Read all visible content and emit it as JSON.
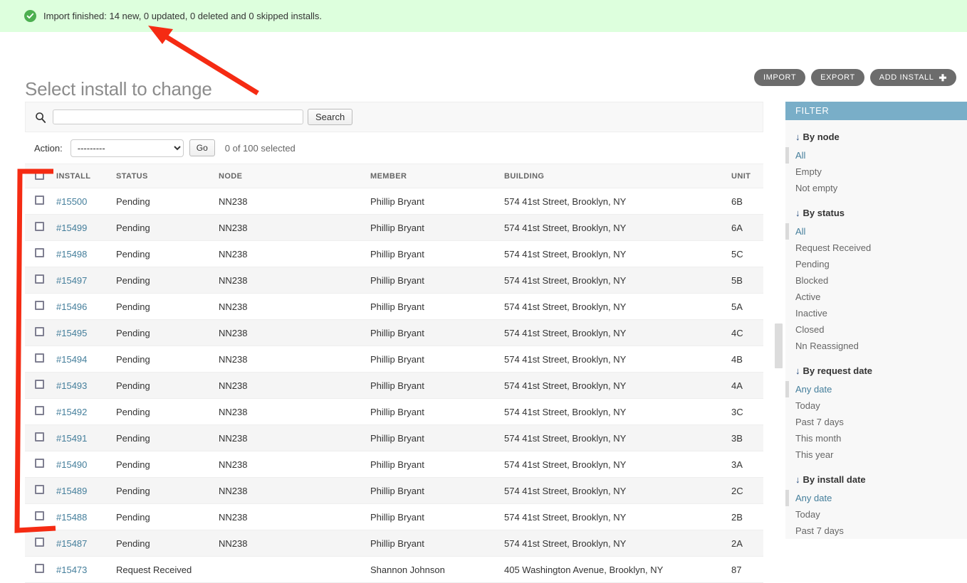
{
  "banner": {
    "icon": "check-circle-icon",
    "message": "Import finished: 14 new, 0 updated, 0 deleted and 0 skipped installs."
  },
  "header": {
    "title": "Select install to change",
    "tools": [
      {
        "label": "IMPORT",
        "name": "import-button"
      },
      {
        "label": "EXPORT",
        "name": "export-button"
      },
      {
        "label": "ADD INSTALL",
        "name": "add-install-button",
        "plus": "➕"
      }
    ]
  },
  "search": {
    "icon": "search-icon",
    "value": "",
    "placeholder": "",
    "submit_label": "Search"
  },
  "actions": {
    "label": "Action:",
    "selected": "---------",
    "options": [
      "---------"
    ],
    "go_label": "Go",
    "counter": "0 of 100 selected"
  },
  "table": {
    "select_all_name": "select-all-checkbox",
    "columns": [
      "INSTALL",
      "STATUS",
      "NODE",
      "MEMBER",
      "BUILDING",
      "UNIT"
    ],
    "rows": [
      {
        "install": "#15500",
        "status": "Pending",
        "node": "NN238",
        "member": "Phillip Bryant",
        "building": "574 41st Street, Brooklyn, NY",
        "unit": "6B"
      },
      {
        "install": "#15499",
        "status": "Pending",
        "node": "NN238",
        "member": "Phillip Bryant",
        "building": "574 41st Street, Brooklyn, NY",
        "unit": "6A"
      },
      {
        "install": "#15498",
        "status": "Pending",
        "node": "NN238",
        "member": "Phillip Bryant",
        "building": "574 41st Street, Brooklyn, NY",
        "unit": "5C"
      },
      {
        "install": "#15497",
        "status": "Pending",
        "node": "NN238",
        "member": "Phillip Bryant",
        "building": "574 41st Street, Brooklyn, NY",
        "unit": "5B"
      },
      {
        "install": "#15496",
        "status": "Pending",
        "node": "NN238",
        "member": "Phillip Bryant",
        "building": "574 41st Street, Brooklyn, NY",
        "unit": "5A"
      },
      {
        "install": "#15495",
        "status": "Pending",
        "node": "NN238",
        "member": "Phillip Bryant",
        "building": "574 41st Street, Brooklyn, NY",
        "unit": "4C"
      },
      {
        "install": "#15494",
        "status": "Pending",
        "node": "NN238",
        "member": "Phillip Bryant",
        "building": "574 41st Street, Brooklyn, NY",
        "unit": "4B"
      },
      {
        "install": "#15493",
        "status": "Pending",
        "node": "NN238",
        "member": "Phillip Bryant",
        "building": "574 41st Street, Brooklyn, NY",
        "unit": "4A"
      },
      {
        "install": "#15492",
        "status": "Pending",
        "node": "NN238",
        "member": "Phillip Bryant",
        "building": "574 41st Street, Brooklyn, NY",
        "unit": "3C"
      },
      {
        "install": "#15491",
        "status": "Pending",
        "node": "NN238",
        "member": "Phillip Bryant",
        "building": "574 41st Street, Brooklyn, NY",
        "unit": "3B"
      },
      {
        "install": "#15490",
        "status": "Pending",
        "node": "NN238",
        "member": "Phillip Bryant",
        "building": "574 41st Street, Brooklyn, NY",
        "unit": "3A"
      },
      {
        "install": "#15489",
        "status": "Pending",
        "node": "NN238",
        "member": "Phillip Bryant",
        "building": "574 41st Street, Brooklyn, NY",
        "unit": "2C"
      },
      {
        "install": "#15488",
        "status": "Pending",
        "node": "NN238",
        "member": "Phillip Bryant",
        "building": "574 41st Street, Brooklyn, NY",
        "unit": "2B"
      },
      {
        "install": "#15487",
        "status": "Pending",
        "node": "NN238",
        "member": "Phillip Bryant",
        "building": "574 41st Street, Brooklyn, NY",
        "unit": "2A"
      },
      {
        "install": "#15473",
        "status": "Request Received",
        "node": "",
        "member": "Shannon Johnson",
        "building": "405 Washington Avenue, Brooklyn, NY",
        "unit": "87"
      }
    ]
  },
  "filter": {
    "title": "FILTER",
    "arrow_glyph": "↓",
    "groups": [
      {
        "title": "By node",
        "items": [
          {
            "label": "All",
            "selected": true
          },
          {
            "label": "Empty",
            "selected": false
          },
          {
            "label": "Not empty",
            "selected": false
          }
        ]
      },
      {
        "title": "By status",
        "items": [
          {
            "label": "All",
            "selected": true
          },
          {
            "label": "Request Received",
            "selected": false
          },
          {
            "label": "Pending",
            "selected": false
          },
          {
            "label": "Blocked",
            "selected": false
          },
          {
            "label": "Active",
            "selected": false
          },
          {
            "label": "Inactive",
            "selected": false
          },
          {
            "label": "Closed",
            "selected": false
          },
          {
            "label": "Nn Reassigned",
            "selected": false
          }
        ]
      },
      {
        "title": "By request date",
        "items": [
          {
            "label": "Any date",
            "selected": true
          },
          {
            "label": "Today",
            "selected": false
          },
          {
            "label": "Past 7 days",
            "selected": false
          },
          {
            "label": "This month",
            "selected": false
          },
          {
            "label": "This year",
            "selected": false
          }
        ]
      },
      {
        "title": "By install date",
        "items": [
          {
            "label": "Any date",
            "selected": true
          },
          {
            "label": "Today",
            "selected": false
          },
          {
            "label": "Past 7 days",
            "selected": false
          }
        ]
      }
    ]
  },
  "colors": {
    "banner_bg": "#ddffdd",
    "success_green": "#4caf50",
    "filter_header": "#79aec8",
    "link_blue": "#447e9b",
    "tool_button": "#6c6c6c",
    "annotation_red": "#f52b13"
  }
}
